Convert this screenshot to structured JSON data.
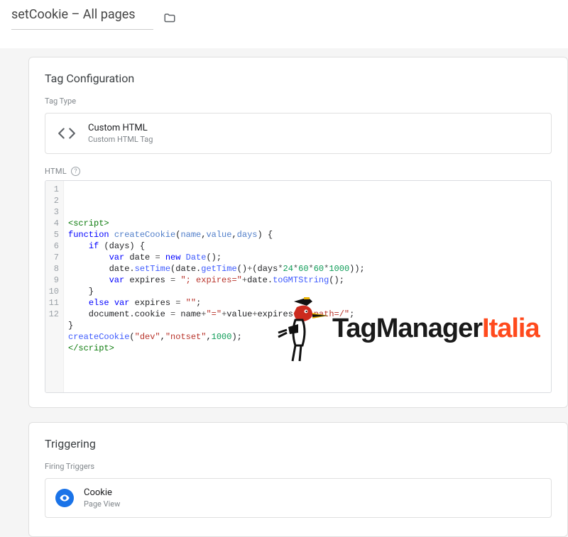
{
  "header": {
    "title": "setCookie – All pages"
  },
  "tagConfig": {
    "cardTitle": "Tag Configuration",
    "typeLabel": "Tag Type",
    "typeName": "Custom HTML",
    "typeSub": "Custom HTML Tag",
    "htmlLabel": "HTML",
    "code": {
      "lines": [
        {
          "n": 1,
          "html": "<span class='tok-tag'>&lt;script&gt;</span>"
        },
        {
          "n": 2,
          "html": "<span class='tok-kw'>function</span> <span class='tok-def'>createCookie</span>(<span class='tok-def'>name</span>,<span class='tok-def'>value</span>,<span class='tok-def'>days</span>) {"
        },
        {
          "n": 3,
          "html": "    <span class='tok-kw'>if</span> (days) {"
        },
        {
          "n": 4,
          "html": "        <span class='tok-kw'>var</span> date <span class='tok-punc'>=</span> <span class='tok-kw'>new</span> <span class='tok-fn'>Date</span>();"
        },
        {
          "n": 5,
          "html": "        date.<span class='tok-fn'>setTime</span>(date.<span class='tok-fn'>getTime</span>()<span class='tok-punc'>+</span>(days<span class='tok-punc'>*</span><span class='tok-num'>24</span><span class='tok-punc'>*</span><span class='tok-num'>60</span><span class='tok-punc'>*</span><span class='tok-num'>60</span><span class='tok-punc'>*</span><span class='tok-num'>1000</span>));"
        },
        {
          "n": 6,
          "html": "        <span class='tok-kw'>var</span> expires <span class='tok-punc'>=</span> <span class='tok-str'>&quot;; expires=&quot;</span><span class='tok-punc'>+</span>date.<span class='tok-fn'>toGMTString</span>();"
        },
        {
          "n": 7,
          "html": "    }"
        },
        {
          "n": 8,
          "html": "    <span class='tok-kw'>else</span> <span class='tok-kw'>var</span> expires <span class='tok-punc'>=</span> <span class='tok-str'>&quot;&quot;</span>;"
        },
        {
          "n": 9,
          "html": "    document.cookie <span class='tok-punc'>=</span> name<span class='tok-punc'>+</span><span class='tok-str'>&quot;=&quot;</span><span class='tok-punc'>+</span>value<span class='tok-punc'>+</span>expires<span class='tok-punc'>+</span><span class='tok-str'>&quot;; path=/&quot;</span>;"
        },
        {
          "n": 10,
          "html": "}"
        },
        {
          "n": 11,
          "html": "<span class='tok-fn'>createCookie</span>(<span class='tok-str'>&quot;dev&quot;</span>,<span class='tok-str'>&quot;notset&quot;</span>,<span class='tok-num'>1000</span>);"
        },
        {
          "n": 12,
          "html": "<span class='tok-tag'>&lt;/script&gt;</span>"
        }
      ]
    }
  },
  "watermark": {
    "brandA": "TagManager",
    "brandB": "Italia"
  },
  "triggering": {
    "cardTitle": "Triggering",
    "firingLabel": "Firing Triggers",
    "triggerName": "Cookie",
    "triggerSub": "Page View"
  }
}
